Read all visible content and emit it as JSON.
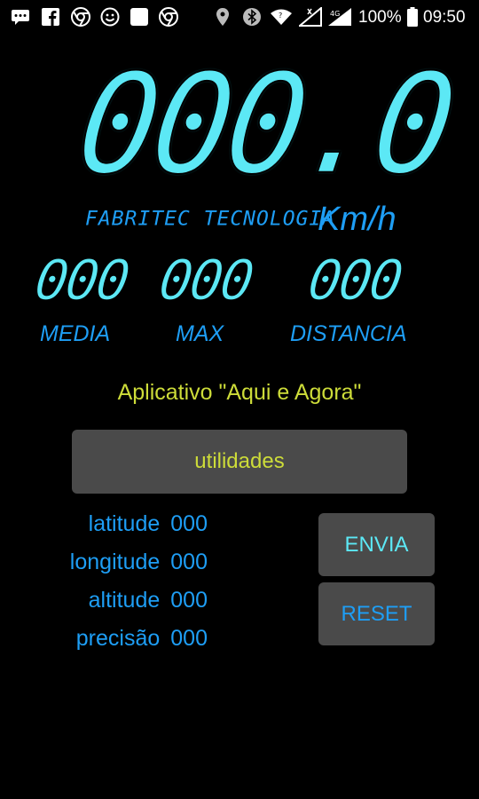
{
  "status_bar": {
    "battery_percent": "100%",
    "time": "09:50",
    "notification_icons": [
      "messages-icon",
      "facebook-icon",
      "chrome-icon",
      "smiley-icon",
      "blank-app-icon",
      "chrome-icon"
    ],
    "system_icons": [
      "location-icon",
      "bluetooth-icon",
      "wifi-icon",
      "signal-icon",
      "signal-4g-icon",
      "battery-icon"
    ]
  },
  "speedometer": {
    "speed_value": "000.0",
    "brand": "FABRITEC TECNOLOGIA",
    "unit": "Km/h"
  },
  "stats": [
    {
      "value": "000",
      "label": "MEDIA"
    },
    {
      "value": "000",
      "label": "MAX"
    },
    {
      "value": "000",
      "label": "DISTANCIA"
    }
  ],
  "app_title": "Aplicativo \"Aqui e Agora\"",
  "buttons": {
    "utilidades": "utilidades",
    "envia": "ENVIA",
    "reset": "RESET"
  },
  "geo": [
    {
      "label": "latitude",
      "value": "000"
    },
    {
      "label": "longitude",
      "value": "000"
    },
    {
      "label": "altitude",
      "value": "000"
    },
    {
      "label": "precisão",
      "value": "000"
    }
  ],
  "colors": {
    "background": "#000000",
    "digit_cyan": "#5ce8f5",
    "label_blue": "#1e9ef5",
    "title_lime": "#cddc39",
    "button_gray": "#4a4a4a"
  }
}
